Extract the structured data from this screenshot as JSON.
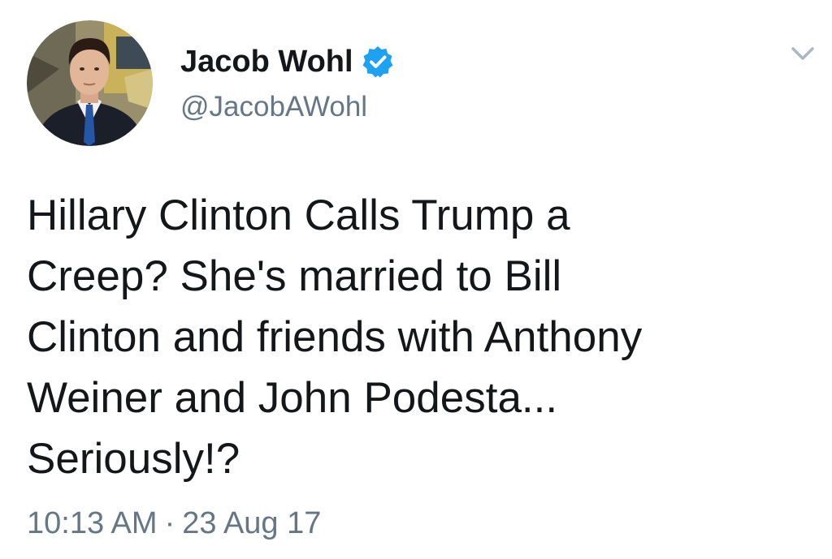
{
  "author": {
    "display_name": "Jacob Wohl",
    "handle": "@JacobAWohl",
    "verified": true,
    "avatar_icon": "profile-photo-avatar",
    "verified_icon": "verified-check-badge-icon",
    "menu_icon": "chevron-down-icon"
  },
  "tweet": {
    "text_lines": [
      "Hillary Clinton Calls Trump a",
      "Creep? She's married to Bill",
      "Clinton and friends with Anthony",
      "Weiner and John Podesta...",
      "Seriously!?"
    ],
    "time": "10:13 AM",
    "separator": "·",
    "date": "23 Aug 17"
  },
  "colors": {
    "text_primary": "#14171a",
    "text_secondary": "#657786",
    "verified_blue": "#1da1f2",
    "caret_gray": "#aab8c2",
    "background": "#ffffff"
  }
}
